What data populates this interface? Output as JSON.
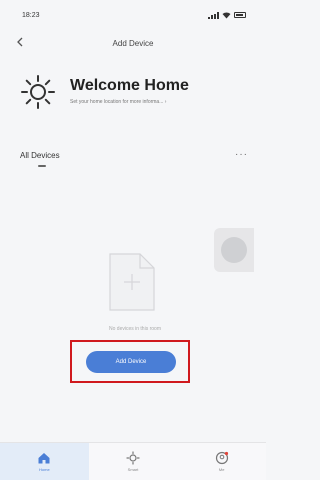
{
  "status_bar": {
    "time": "18:23"
  },
  "nav": {
    "title": "Add Device",
    "back_icon": "chevron-left-icon"
  },
  "welcome": {
    "title": "Welcome Home",
    "subtitle": "Set your home location for more informa...",
    "icon": "sun-icon"
  },
  "devices": {
    "section_title": "All Devices",
    "more_label": "···",
    "empty_text": "No devices in this room",
    "add_button_label": "Add Device"
  },
  "tabs": [
    {
      "label": "Home",
      "icon": "home-icon",
      "active": true
    },
    {
      "label": "Smart",
      "icon": "smart-icon",
      "active": false
    },
    {
      "label": "Me",
      "icon": "profile-icon",
      "active": false
    }
  ],
  "colors": {
    "accent": "#4a7ed6",
    "highlight_border": "#d0191e",
    "background": "#f5f6f8"
  }
}
